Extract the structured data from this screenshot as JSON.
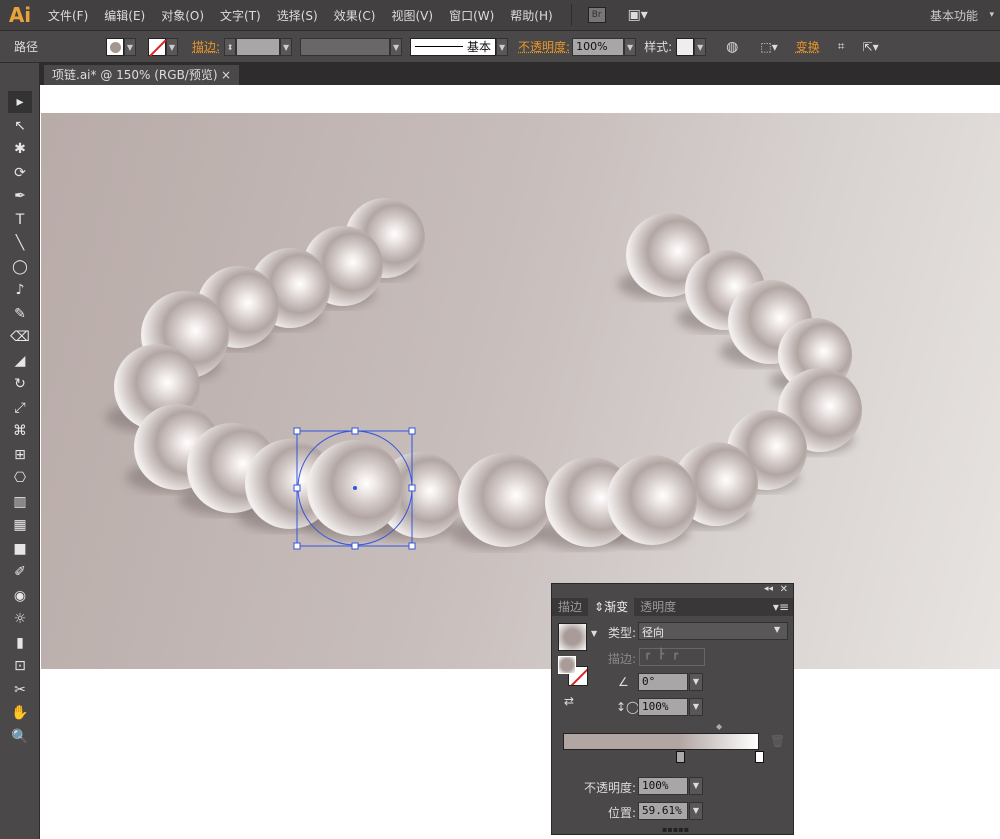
{
  "app": {
    "logo": "Ai"
  },
  "menu": [
    "文件(F)",
    "编辑(E)",
    "对象(O)",
    "文字(T)",
    "选择(S)",
    "效果(C)",
    "视图(V)",
    "窗口(W)",
    "帮助(H)"
  ],
  "menubar_right": {
    "bridge": "Br",
    "workspace": "基本功能"
  },
  "control": {
    "object_type": "路径",
    "stroke_label": "描边:",
    "brush": "基本",
    "opacity_label": "不透明度:",
    "opacity": "100%",
    "style_label": "样式:",
    "transform": "变换"
  },
  "document": {
    "tab": "项链.ai* @ 150% (RGB/预览)",
    "close": "×"
  },
  "tools": [
    "▸",
    "↖",
    "✱",
    "⟳",
    "✒",
    "T",
    "╲",
    "◯",
    "♪",
    "✎",
    "⌫",
    "◢",
    "↻",
    "⤢",
    "⌘",
    "⊞",
    "⎔",
    "▥",
    "▦",
    "■",
    "✐",
    "◉",
    "☼",
    "▮",
    "⊡",
    "✂",
    "✋",
    "🔍"
  ],
  "gradient_panel": {
    "tabs": [
      "描边",
      "渐变",
      "透明度"
    ],
    "active_tab": "渐变",
    "type_label": "类型:",
    "type": "径向",
    "stroke_label": "描边:",
    "angle": "0°",
    "aspect": "100%",
    "opacity_label": "不透明度:",
    "opacity": "100%",
    "position_label": "位置:",
    "position": "59.61%",
    "stops": [
      {
        "location": 59.61,
        "color": "#b2a6a3"
      },
      {
        "location": 100,
        "color": "#ffffff"
      }
    ]
  },
  "colors": {
    "accent": "#e8a33a",
    "selection": "#3355dd",
    "pearl_dark": "#a89b98",
    "pearl_light": "#ffffff"
  }
}
